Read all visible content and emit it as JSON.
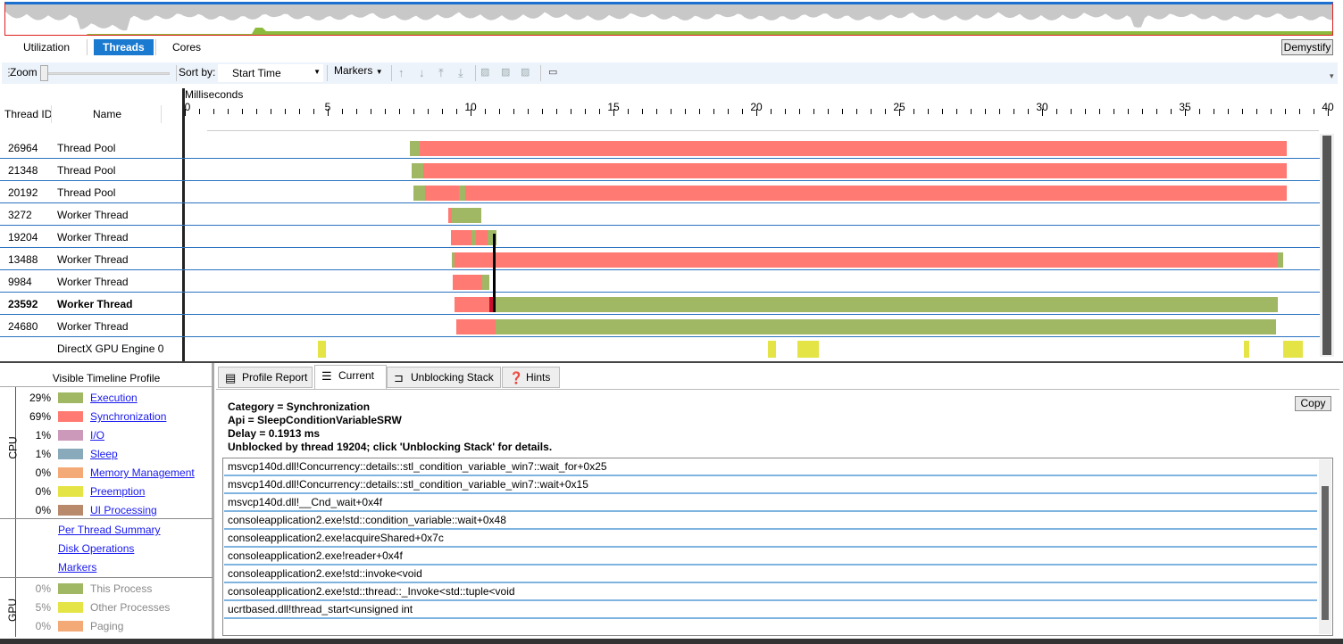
{
  "view_tabs": [
    {
      "label": "Utilization"
    },
    {
      "label": "Threads",
      "active": true
    },
    {
      "label": "Cores"
    }
  ],
  "demystify_label": "Demystify",
  "toolbar": {
    "zoom_label": "Zoom",
    "zoom_level": 0,
    "sort_label": "Sort by:",
    "sort_value": "Start Time",
    "markers_label": "Markers"
  },
  "timeline": {
    "unit_label": "Milliseconds",
    "ticks": [
      "0",
      "5",
      "10",
      "15",
      "20",
      "25",
      "30",
      "35",
      "40"
    ],
    "range_ms": [
      0,
      40
    ],
    "col_thread_id": "Thread ID",
    "col_name": "Name",
    "colors": {
      "exec": "#a0b864",
      "sync": "#ff7a72",
      "selected": "#c8102e",
      "gpu": "#e4e446"
    },
    "threads": [
      {
        "id": "26964",
        "name": "Thread Pool",
        "segments": [
          [
            7.88,
            8.22,
            "exec"
          ],
          [
            8.22,
            38.56,
            "sync"
          ]
        ]
      },
      {
        "id": "21348",
        "name": "Thread Pool",
        "segments": [
          [
            7.94,
            8.34,
            "exec"
          ],
          [
            8.34,
            38.56,
            "sync"
          ]
        ]
      },
      {
        "id": "20192",
        "name": "Thread Pool",
        "segments": [
          [
            8.0,
            8.4,
            "exec"
          ],
          [
            8.4,
            9.6,
            "sync"
          ],
          [
            9.6,
            9.8,
            "exec"
          ],
          [
            9.8,
            38.56,
            "sync"
          ]
        ]
      },
      {
        "id": "3272",
        "name": "Worker Thread",
        "segments": [
          [
            9.22,
            9.34,
            "sync"
          ],
          [
            9.34,
            10.37,
            "exec"
          ]
        ]
      },
      {
        "id": "19204",
        "name": "Worker Thread",
        "segments": [
          [
            9.31,
            10.03,
            "sync"
          ],
          [
            10.03,
            10.2,
            "exec"
          ],
          [
            10.2,
            10.6,
            "sync"
          ],
          [
            10.6,
            10.9,
            "exec"
          ]
        ]
      },
      {
        "id": "13488",
        "name": "Worker Thread",
        "segments": [
          [
            9.34,
            9.44,
            "exec"
          ],
          [
            9.44,
            38.25,
            "sync"
          ],
          [
            38.25,
            38.44,
            "exec"
          ]
        ]
      },
      {
        "id": "9984",
        "name": "Worker Thread",
        "segments": [
          [
            9.38,
            10.41,
            "sync"
          ],
          [
            10.41,
            10.66,
            "exec"
          ]
        ]
      },
      {
        "id": "23592",
        "name": "Worker Thread",
        "bold": true,
        "segments": [
          [
            9.44,
            10.66,
            "sync"
          ],
          [
            10.66,
            10.87,
            "selected"
          ],
          [
            10.87,
            38.25,
            "exec"
          ]
        ]
      },
      {
        "id": "24680",
        "name": "Worker Thread",
        "segments": [
          [
            9.5,
            10.87,
            "sync"
          ],
          [
            10.87,
            38.19,
            "exec"
          ]
        ]
      },
      {
        "id": "",
        "name": "DirectX GPU Engine 0",
        "segments": [
          [
            4.66,
            4.94,
            "gpu"
          ],
          [
            20.41,
            20.69,
            "gpu"
          ],
          [
            21.44,
            22.19,
            "gpu"
          ],
          [
            37.06,
            37.25,
            "gpu"
          ],
          [
            38.44,
            39.13,
            "gpu"
          ]
        ]
      }
    ]
  },
  "profile": {
    "title": "Visible Timeline Profile",
    "cpu_label": "CPU",
    "gpu_label": "GPU",
    "cpu": [
      {
        "pct": "29%",
        "label": "Execution",
        "color": "#a0b864"
      },
      {
        "pct": "69%",
        "label": "Synchronization",
        "color": "#ff7a72"
      },
      {
        "pct": "1%",
        "label": "I/O",
        "color": "#cc99bb"
      },
      {
        "pct": "1%",
        "label": "Sleep",
        "color": "#88aabb"
      },
      {
        "pct": "0%",
        "label": "Memory Management",
        "color": "#f4aa77"
      },
      {
        "pct": "0%",
        "label": "Preemption",
        "color": "#e4e446"
      },
      {
        "pct": "0%",
        "label": "UI Processing",
        "color": "#b8896a"
      }
    ],
    "links": [
      "Per Thread Summary",
      "Disk Operations",
      "Markers"
    ],
    "gpu": [
      {
        "pct": "0%",
        "label": "This Process",
        "color": "#a0b864"
      },
      {
        "pct": "5%",
        "label": "Other Processes",
        "color": "#e4e446"
      },
      {
        "pct": "0%",
        "label": "Paging",
        "color": "#f4aa77"
      }
    ]
  },
  "detail": {
    "tabs": [
      {
        "label": "Profile Report",
        "icon": "report-icon"
      },
      {
        "label": "Current",
        "icon": "current-icon",
        "active": true
      },
      {
        "label": "Unblocking Stack",
        "icon": "unblocking-stack-icon"
      },
      {
        "label": "Hints",
        "icon": "help-icon"
      }
    ],
    "copy_label": "Copy",
    "info": [
      "Category = Synchronization",
      "Api = SleepConditionVariableSRW",
      "Delay = 0.1913 ms",
      "Unblocked by thread 19204; click 'Unblocking Stack' for details."
    ],
    "stack": [
      "msvcp140d.dll!Concurrency::details::stl_condition_variable_win7::wait_for+0x25",
      "msvcp140d.dll!Concurrency::details::stl_condition_variable_win7::wait+0x15",
      "msvcp140d.dll!__Cnd_wait+0x4f",
      "consoleapplication2.exe!std::condition_variable::wait+0x48",
      "consoleapplication2.exe!acquireShared+0x7c",
      "consoleapplication2.exe!reader+0x4f",
      "consoleapplication2.exe!std::invoke<void",
      "consoleapplication2.exe!std::thread::_Invoke<std::tuple<void",
      "ucrtbased.dll!thread_start<unsigned int"
    ]
  }
}
